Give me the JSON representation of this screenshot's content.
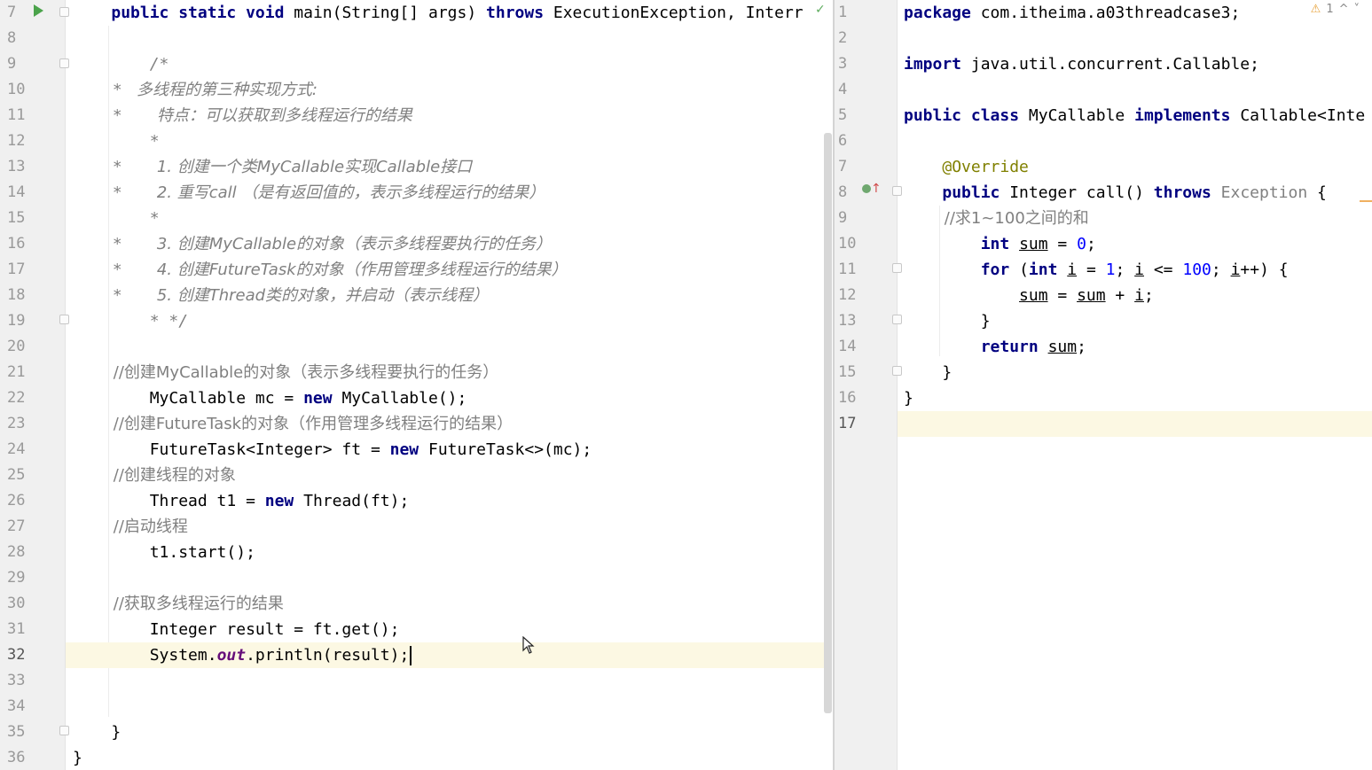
{
  "left_editor": {
    "lines": [
      {
        "n": "7",
        "tokens": [
          {
            "t": "    ",
            "c": ""
          },
          {
            "t": "public static void ",
            "c": "kw"
          },
          {
            "t": "main(String[] args) ",
            "c": ""
          },
          {
            "t": "throws ",
            "c": "kw"
          },
          {
            "t": "ExecutionException, Interr",
            "c": ""
          }
        ]
      },
      {
        "n": "8",
        "tokens": []
      },
      {
        "n": "9",
        "tokens": [
          {
            "t": "        /*",
            "c": "cm"
          }
        ]
      },
      {
        "n": "10",
        "tokens": [
          {
            "t": "        *   多线程的第三种实现方式:",
            "c": "cm"
          }
        ]
      },
      {
        "n": "11",
        "tokens": [
          {
            "t": "        *       特点：可以获取到多线程运行的结果",
            "c": "cm"
          }
        ]
      },
      {
        "n": "12",
        "tokens": [
          {
            "t": "        *",
            "c": "cm"
          }
        ]
      },
      {
        "n": "13",
        "tokens": [
          {
            "t": "        *       1. 创建一个类MyCallable实现Callable接口",
            "c": "cm"
          }
        ]
      },
      {
        "n": "14",
        "tokens": [
          {
            "t": "        *       2. 重写call （是有返回值的，表示多线程运行的结果）",
            "c": "cm"
          }
        ]
      },
      {
        "n": "15",
        "tokens": [
          {
            "t": "        *",
            "c": "cm"
          }
        ]
      },
      {
        "n": "16",
        "tokens": [
          {
            "t": "        *       3. 创建MyCallable的对象（表示多线程要执行的任务）",
            "c": "cm"
          }
        ]
      },
      {
        "n": "17",
        "tokens": [
          {
            "t": "        *       4. 创建FutureTask的对象（作用管理多线程运行的结果）",
            "c": "cm"
          }
        ]
      },
      {
        "n": "18",
        "tokens": [
          {
            "t": "        *       5. 创建Thread类的对象，并启动（表示线程）",
            "c": "cm"
          }
        ]
      },
      {
        "n": "19",
        "tokens": [
          {
            "t": "        * */",
            "c": "cm"
          }
        ]
      },
      {
        "n": "20",
        "tokens": []
      },
      {
        "n": "21",
        "tokens": [
          {
            "t": "        //创建MyCallable的对象（表示多线程要执行的任务）",
            "c": "cmt"
          }
        ]
      },
      {
        "n": "22",
        "tokens": [
          {
            "t": "        MyCallable mc = ",
            "c": ""
          },
          {
            "t": "new ",
            "c": "kw"
          },
          {
            "t": "MyCallable();",
            "c": ""
          }
        ]
      },
      {
        "n": "23",
        "tokens": [
          {
            "t": "        //创建FutureTask的对象（作用管理多线程运行的结果）",
            "c": "cmt"
          }
        ]
      },
      {
        "n": "24",
        "tokens": [
          {
            "t": "        FutureTask<Integer> ft = ",
            "c": ""
          },
          {
            "t": "new ",
            "c": "kw"
          },
          {
            "t": "FutureTask<>(mc);",
            "c": ""
          }
        ]
      },
      {
        "n": "25",
        "tokens": [
          {
            "t": "        //创建线程的对象",
            "c": "cmt"
          }
        ]
      },
      {
        "n": "26",
        "tokens": [
          {
            "t": "        Thread t1 = ",
            "c": ""
          },
          {
            "t": "new ",
            "c": "kw"
          },
          {
            "t": "Thread(ft);",
            "c": ""
          }
        ]
      },
      {
        "n": "27",
        "tokens": [
          {
            "t": "        //启动线程",
            "c": "cmt"
          }
        ]
      },
      {
        "n": "28",
        "tokens": [
          {
            "t": "        t1.start();",
            "c": ""
          }
        ]
      },
      {
        "n": "29",
        "tokens": []
      },
      {
        "n": "30",
        "tokens": [
          {
            "t": "        //获取多线程运行的结果",
            "c": "cmt"
          }
        ]
      },
      {
        "n": "31",
        "tokens": [
          {
            "t": "        Integer result = ft.get();",
            "c": ""
          }
        ]
      },
      {
        "n": "32",
        "tokens": [
          {
            "t": "        System.",
            "c": ""
          },
          {
            "t": "out",
            "c": "st"
          },
          {
            "t": ".println(result);",
            "c": ""
          }
        ],
        "caret": true
      },
      {
        "n": "33",
        "tokens": []
      },
      {
        "n": "34",
        "tokens": []
      },
      {
        "n": "35",
        "tokens": [
          {
            "t": "    }",
            "c": ""
          }
        ]
      },
      {
        "n": "36",
        "tokens": [
          {
            "t": "}",
            "c": ""
          }
        ]
      }
    ]
  },
  "right_editor": {
    "inspection": {
      "warnings": "1",
      "up": "^",
      "down": "˅"
    },
    "lines": [
      {
        "n": "1",
        "tokens": [
          {
            "t": "package ",
            "c": "kw"
          },
          {
            "t": "com.itheima.a03threadcase3;",
            "c": ""
          }
        ]
      },
      {
        "n": "2",
        "tokens": []
      },
      {
        "n": "3",
        "tokens": [
          {
            "t": "import ",
            "c": "kw"
          },
          {
            "t": "java.util.concurrent.Callable;",
            "c": ""
          }
        ]
      },
      {
        "n": "4",
        "tokens": []
      },
      {
        "n": "5",
        "tokens": [
          {
            "t": "public class ",
            "c": "kw"
          },
          {
            "t": "MyCallable ",
            "c": ""
          },
          {
            "t": "implements ",
            "c": "kw"
          },
          {
            "t": "Callable<Inte",
            "c": ""
          }
        ]
      },
      {
        "n": "6",
        "tokens": []
      },
      {
        "n": "7",
        "tokens": [
          {
            "t": "    ",
            "c": ""
          },
          {
            "t": "@Override",
            "c": "ann"
          }
        ]
      },
      {
        "n": "8",
        "tokens": [
          {
            "t": "    ",
            "c": ""
          },
          {
            "t": "public ",
            "c": "kw"
          },
          {
            "t": "Integer call() ",
            "c": ""
          },
          {
            "t": "throws ",
            "c": "kw"
          },
          {
            "t": "Exception",
            "c": "gray"
          },
          {
            "t": " {",
            "c": ""
          }
        ]
      },
      {
        "n": "9",
        "tokens": [
          {
            "t": "        //求1~100之间的和",
            "c": "cmt"
          }
        ]
      },
      {
        "n": "10",
        "tokens": [
          {
            "t": "        ",
            "c": ""
          },
          {
            "t": "int ",
            "c": "kw"
          },
          {
            "t": "sum",
            "c": "uline"
          },
          {
            "t": " = ",
            "c": ""
          },
          {
            "t": "0",
            "c": "num"
          },
          {
            "t": ";",
            "c": ""
          }
        ]
      },
      {
        "n": "11",
        "tokens": [
          {
            "t": "        ",
            "c": ""
          },
          {
            "t": "for ",
            "c": "kw"
          },
          {
            "t": "(",
            "c": ""
          },
          {
            "t": "int ",
            "c": "kw"
          },
          {
            "t": "i",
            "c": "uline"
          },
          {
            "t": " = ",
            "c": ""
          },
          {
            "t": "1",
            "c": "num"
          },
          {
            "t": "; ",
            "c": ""
          },
          {
            "t": "i",
            "c": "uline"
          },
          {
            "t": " <= ",
            "c": ""
          },
          {
            "t": "100",
            "c": "num"
          },
          {
            "t": "; ",
            "c": ""
          },
          {
            "t": "i",
            "c": "uline"
          },
          {
            "t": "++) {",
            "c": ""
          }
        ]
      },
      {
        "n": "12",
        "tokens": [
          {
            "t": "            ",
            "c": ""
          },
          {
            "t": "sum",
            "c": "uline"
          },
          {
            "t": " = ",
            "c": ""
          },
          {
            "t": "sum",
            "c": "uline"
          },
          {
            "t": " + ",
            "c": ""
          },
          {
            "t": "i",
            "c": "uline"
          },
          {
            "t": ";",
            "c": ""
          }
        ]
      },
      {
        "n": "13",
        "tokens": [
          {
            "t": "        }",
            "c": ""
          }
        ]
      },
      {
        "n": "14",
        "tokens": [
          {
            "t": "        ",
            "c": ""
          },
          {
            "t": "return ",
            "c": "kw"
          },
          {
            "t": "sum",
            "c": "uline"
          },
          {
            "t": ";",
            "c": ""
          }
        ]
      },
      {
        "n": "15",
        "tokens": [
          {
            "t": "    }",
            "c": ""
          }
        ]
      },
      {
        "n": "16",
        "tokens": [
          {
            "t": "}",
            "c": ""
          }
        ]
      },
      {
        "n": "17",
        "tokens": [],
        "caret": true
      }
    ]
  },
  "icons": {
    "run": "run-icon",
    "inspection_ok": "check-icon",
    "warning": "warning-icon",
    "override": "override-icon"
  },
  "colors": {
    "keyword": "#000080",
    "comment": "#808080",
    "number": "#0000ff",
    "annotation": "#808000",
    "caret_line": "#fcf8e3",
    "gutter": "#f0f0f0"
  }
}
